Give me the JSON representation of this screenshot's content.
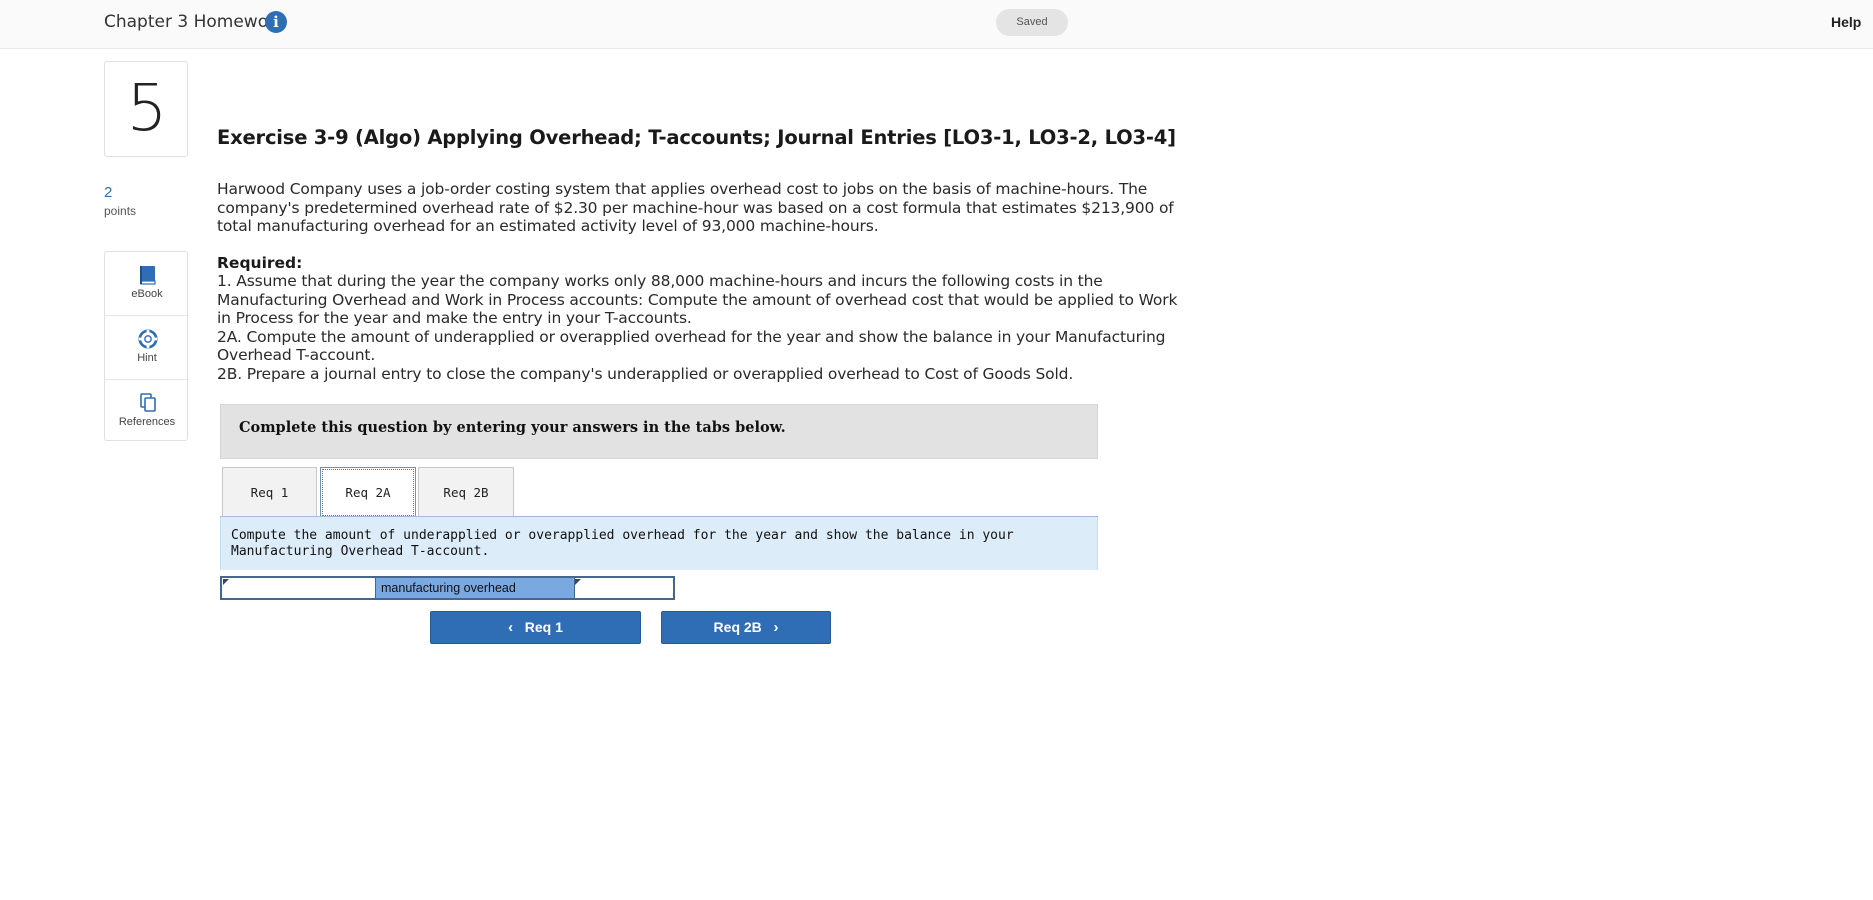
{
  "header": {
    "assignment_title": "Chapter 3 Homework",
    "info_glyph": "i",
    "saved_status": "Saved",
    "help_label": "Help"
  },
  "question": {
    "number": "5",
    "points_value": "2",
    "points_label": "points",
    "tools": [
      {
        "label": "eBook",
        "icon": "book-icon"
      },
      {
        "label": "Hint",
        "icon": "lifebuoy-icon"
      },
      {
        "label": "References",
        "icon": "copy-pages-icon"
      }
    ]
  },
  "exercise": {
    "title": "Exercise 3-9 (Algo) Applying Overhead; T-accounts; Journal Entries [LO3-1, LO3-2, LO3-4]",
    "intro": "Harwood Company uses a job-order costing system that applies overhead cost to jobs on the basis of machine-hours. The company's predetermined overhead rate of $2.30 per machine-hour was based on a cost formula that estimates $213,900 of total manufacturing overhead for an estimated activity level of 93,000 machine-hours.",
    "required_heading": "Required:",
    "required_items": [
      "1. Assume that during the year the company works only 88,000 machine-hours and incurs the following costs in the Manufacturing Overhead and Work in Process accounts: Compute the amount of overhead cost that would be applied to Work in Process for the year and make the entry in your T-accounts.",
      "2A. Compute the amount of underapplied or overapplied overhead for the year and show the balance in your Manufacturing Overhead T-account.",
      "2B. Prepare a journal entry to close the company's underapplied or overapplied overhead to Cost of Goods Sold."
    ]
  },
  "answer_area": {
    "instruction": "Complete this question by entering your answers in the tabs below.",
    "tabs": [
      {
        "label": "Req 1",
        "active": false
      },
      {
        "label": "Req 2A",
        "active": true
      },
      {
        "label": "Req 2B",
        "active": false
      }
    ],
    "task_text": "Compute the amount of underapplied or overapplied overhead for the year and show the balance in your Manufacturing Overhead T-account.",
    "t_account": {
      "title": "manufacturing overhead",
      "left_value": "",
      "right_value": ""
    },
    "prev_button": "Req 1",
    "next_button": "Req 2B"
  },
  "colors": {
    "brand_blue": "#2f6db5",
    "task_bg": "#dcecf8",
    "t_title_bg": "#7aa8e0"
  }
}
